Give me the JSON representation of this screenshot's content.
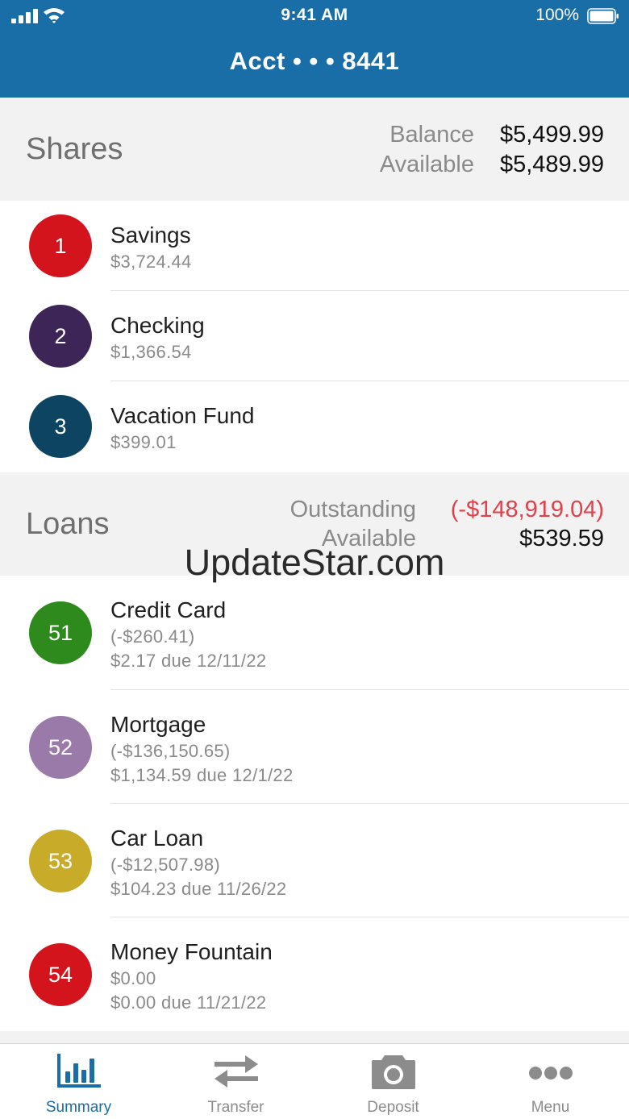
{
  "status_bar": {
    "time": "9:41 AM",
    "battery": "100%"
  },
  "header": {
    "title": "Acct • • • 8441"
  },
  "shares": {
    "title": "Shares",
    "balance_label": "Balance",
    "balance_value": "$5,499.99",
    "available_label": "Available",
    "available_value": "$5,489.99",
    "items": [
      {
        "number": "1",
        "name": "Savings",
        "amount": "$3,724.44",
        "color": "#d4141c"
      },
      {
        "number": "2",
        "name": "Checking",
        "amount": "$1,366.54",
        "color": "#3e2558"
      },
      {
        "number": "3",
        "name": "Vacation Fund",
        "amount": "$399.01",
        "color": "#0c4461"
      }
    ]
  },
  "loans": {
    "title": "Loans",
    "outstanding_label": "Outstanding",
    "outstanding_value": "(-$148,919.04)",
    "available_label": "Available",
    "available_value": "$539.59",
    "items": [
      {
        "number": "51",
        "name": "Credit Card",
        "amount": "(-$260.41)",
        "due": "$2.17 due 12/11/22",
        "color": "#2e8a1c"
      },
      {
        "number": "52",
        "name": "Mortgage",
        "amount": "(-$136,150.65)",
        "due": "$1,134.59 due 12/1/22",
        "color": "#9a7aa8"
      },
      {
        "number": "53",
        "name": "Car Loan",
        "amount": "(-$12,507.98)",
        "due": "$104.23 due 11/26/22",
        "color": "#c9ab2a"
      },
      {
        "number": "54",
        "name": "Money Fountain",
        "amount": "$0.00",
        "due": "$0.00 due 11/21/22",
        "color": "#d4141c"
      }
    ]
  },
  "watermark": "UpdateStar.com",
  "tabs": [
    {
      "label": "Summary",
      "icon": "bar-chart-icon",
      "active": true
    },
    {
      "label": "Transfer",
      "icon": "transfer-arrows-icon",
      "active": false
    },
    {
      "label": "Deposit",
      "icon": "camera-icon",
      "active": false
    },
    {
      "label": "Menu",
      "icon": "more-dots-icon",
      "active": false
    }
  ],
  "colors": {
    "brand": "#1a6ea8",
    "negative": "#e0414a",
    "inactive": "#8c8c8c"
  }
}
